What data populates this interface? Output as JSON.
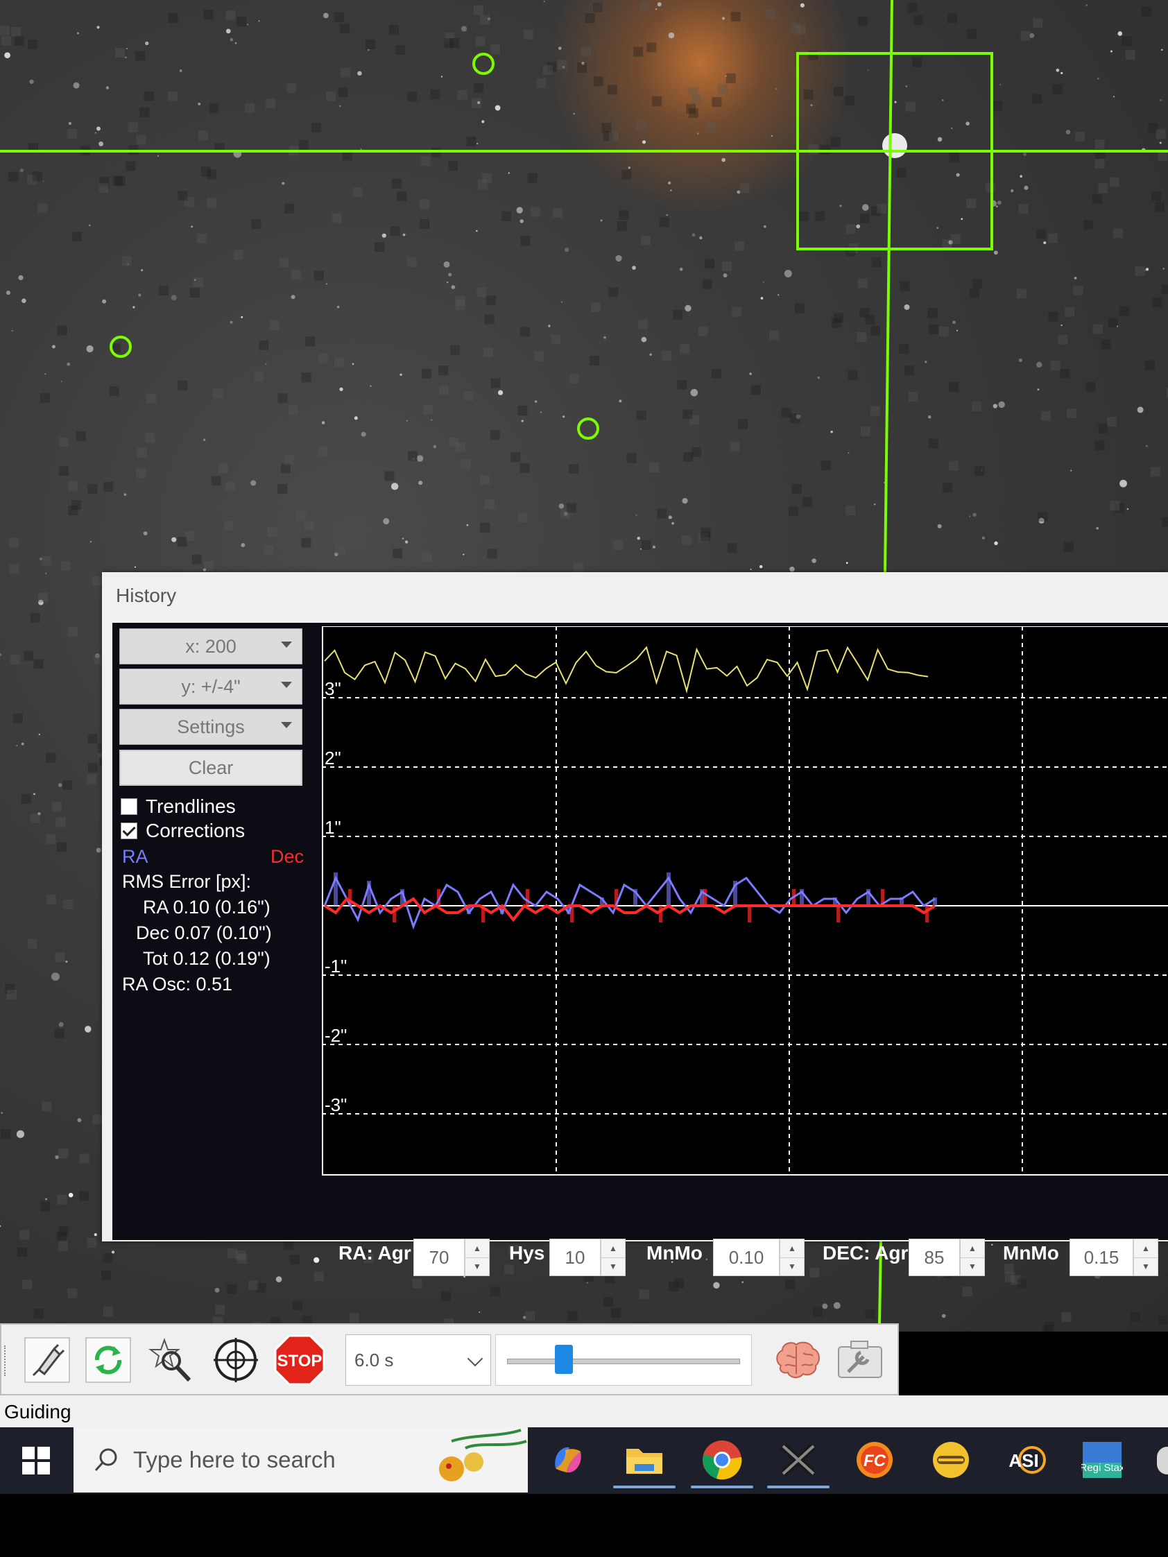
{
  "history_window": {
    "title": "History",
    "x_scale_label": "x: 200",
    "y_scale_label": "y: +/-4\"",
    "settings_label": "Settings",
    "clear_label": "Clear",
    "trendlines_label": "Trendlines",
    "trendlines_checked": false,
    "corrections_label": "Corrections",
    "corrections_checked": true,
    "ra_legend": "RA",
    "dec_legend": "Dec",
    "rms_heading": "RMS Error [px]:",
    "rms_ra": "RA 0.10 (0.16\")",
    "rms_dec": "Dec 0.07 (0.10\")",
    "rms_tot": "Tot 0.12 (0.19\")",
    "ra_osc": "RA Osc: 0.51",
    "colors": {
      "ra": "#7b7bff",
      "dec": "#ff2a2a",
      "snr": "#e8e070",
      "grid": "#ffffff"
    }
  },
  "chart_data": {
    "type": "line",
    "y_tick_labels": [
      "3\"",
      "2\"",
      "1\"",
      "-1\"",
      "-2\"",
      "-3\""
    ],
    "ylim": [
      -4,
      4
    ],
    "x_range": [
      0,
      200
    ],
    "grid": true,
    "series": [
      {
        "name": "RA",
        "values": [
          0.0,
          0.4,
          0.1,
          -0.2,
          0.3,
          -0.1,
          0.1,
          0.2,
          -0.3,
          0.1,
          0.0,
          0.3,
          0.2,
          -0.1,
          0.1,
          0.2,
          -0.1,
          0.3,
          0.1,
          0.0,
          0.2,
          0.1,
          -0.1,
          0.3,
          0.2,
          0.1,
          -0.1,
          0.3,
          0.2,
          0.0,
          0.2,
          0.4,
          0.1,
          -0.1,
          0.2,
          0.1,
          0.0,
          0.3,
          0.4,
          0.2,
          0.0,
          -0.1,
          0.1,
          0.2,
          0.0,
          0.1,
          0.1,
          -0.1,
          0.1,
          0.2,
          0.0,
          0.1,
          0.1,
          0.2,
          0.0,
          0.1
        ]
      },
      {
        "name": "Dec",
        "values": [
          0.0,
          -0.1,
          0.1,
          0.0,
          -0.1,
          0.0,
          -0.1,
          0.0,
          0.1,
          -0.1,
          0.0,
          -0.1,
          -0.1,
          0.0,
          0.0,
          -0.1,
          0.0,
          -0.2,
          0.0,
          -0.1,
          0.0,
          -0.1,
          0.0,
          0.0,
          -0.1,
          0.0,
          0.0,
          -0.1,
          -0.1,
          0.0,
          -0.1,
          0.0,
          -0.1,
          0.0,
          0.0,
          0.0,
          -0.1,
          0.0,
          0.0,
          0.0,
          0.0,
          0.0,
          0.0,
          0.0,
          0.0,
          0.0,
          0.0,
          0.0,
          0.0,
          0.0,
          0.0,
          0.0,
          0.0,
          0.0,
          -0.1,
          0.0
        ]
      }
    ]
  },
  "params": {
    "ra_agr_label": "RA: Agr",
    "ra_agr_value": "70",
    "hys_label": "Hys",
    "hys_value": "10",
    "ra_minmo_label": "MnMo",
    "ra_minmo_value": "0.10",
    "dec_agr_label": "DEC: Agr",
    "dec_agr_value": "85",
    "dec_minmo_label": "MnMo",
    "dec_minmo_value": "0.15"
  },
  "toolbar": {
    "stop_label": "STOP",
    "exposure_value": "6.0 s",
    "gamma_fraction": 0.22
  },
  "status": {
    "text": "Guiding"
  },
  "taskbar": {
    "search_placeholder": "Type here to search",
    "fc_label": "FC",
    "asi_label": "ASI",
    "registax_label": "Regi Stax"
  }
}
